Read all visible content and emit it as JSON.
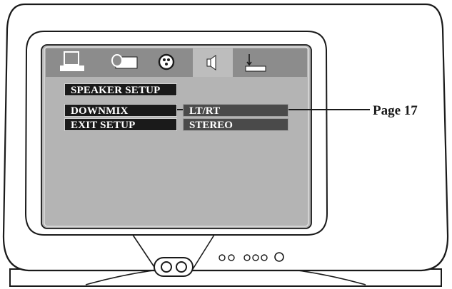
{
  "menu": {
    "title": "SPEAKER SETUP",
    "items": [
      {
        "label": "DOWNMIX",
        "value": "LT/RT"
      },
      {
        "label": "EXIT SETUP",
        "value": "STEREO"
      }
    ]
  },
  "tabs": [
    {
      "icon": "general-setup-icon",
      "active": false
    },
    {
      "icon": "video-setup-icon",
      "active": false
    },
    {
      "icon": "dolby-digital-icon",
      "active": false
    },
    {
      "icon": "speaker-icon",
      "active": true
    },
    {
      "icon": "preference-icon",
      "active": false
    }
  ],
  "callout": {
    "text": "Page 17"
  },
  "colors": {
    "screen": "#b4b4b4",
    "tab_bar": "#8c8c8c",
    "active_tab": "#bdbdbd",
    "label_bg": "#1a1a1a",
    "value_bg": "#4a4a4a",
    "text": "#ffffff"
  }
}
